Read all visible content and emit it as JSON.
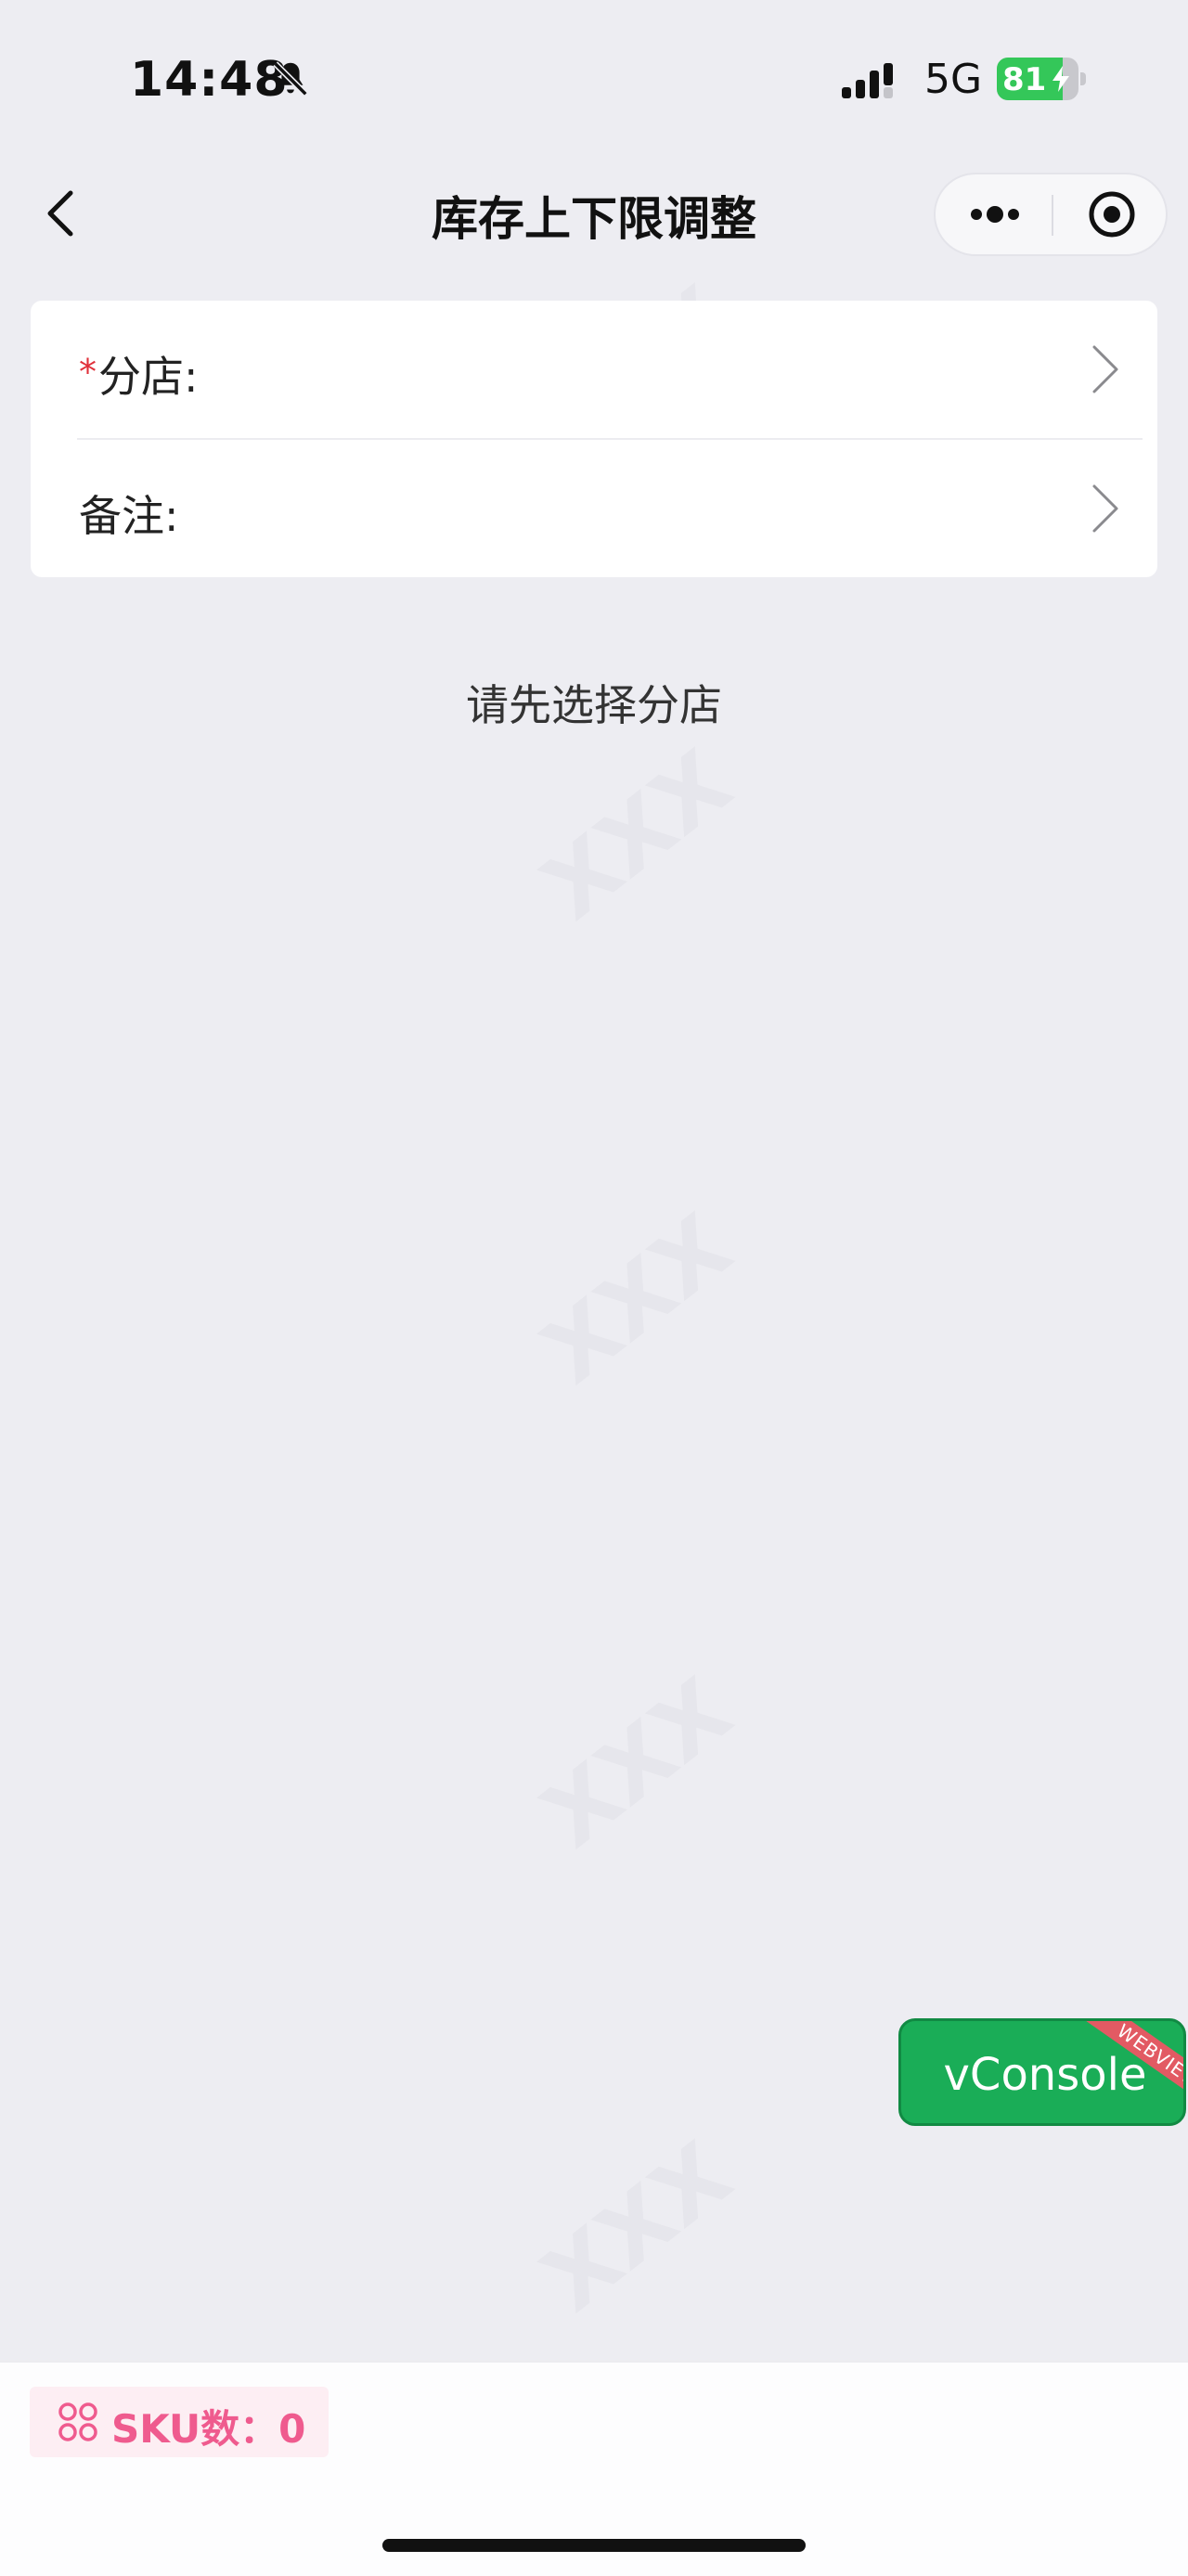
{
  "status_bar": {
    "time": "14:48",
    "network": "5G",
    "battery_level": 81,
    "battery_text": "81",
    "icons": [
      "bell-slash-icon",
      "signal-icon",
      "battery-charging-icon"
    ]
  },
  "nav": {
    "title": "库存上下限调整",
    "icons": [
      "chevron-left-icon",
      "more-icon",
      "close-circle-icon"
    ]
  },
  "form": {
    "fields": [
      {
        "label": "分店:",
        "required": true,
        "required_mark": "*"
      },
      {
        "label": "备注:",
        "required": false
      }
    ]
  },
  "empty_hint": "请先选择分店",
  "vconsole": {
    "label": "vConsole",
    "ribbon": "WEBVIEW",
    "color": "#1aad57"
  },
  "footer": {
    "sku_label": "SKU数：0",
    "accent": "#ef5b8e"
  },
  "colors": {
    "page_background": "#ededf2",
    "required": "#e0303a"
  }
}
